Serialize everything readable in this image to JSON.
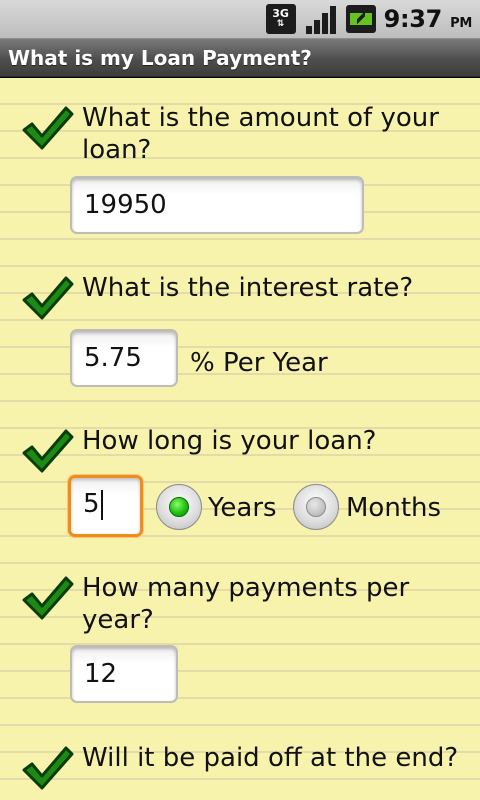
{
  "status_bar": {
    "network": "3G",
    "time": "9:37",
    "ampm": "PM"
  },
  "title_bar": {
    "title": "What is my Loan Payment?"
  },
  "questions": [
    {
      "label": "What is the amount of your loan?",
      "label_line1": "What is the amount of your",
      "label_line2": "loan?",
      "value": "19950"
    },
    {
      "label": "What is the interest rate?",
      "value": "5.75",
      "unit": "% Per Year"
    },
    {
      "label": "How long is your loan?",
      "value": "5",
      "options": [
        "Years",
        "Months"
      ],
      "selected": "Years"
    },
    {
      "label": "How many payments per year?",
      "label_line1": "How many payments per",
      "label_line2": "year?",
      "value": "12"
    },
    {
      "label": "Will it be paid off at the end?"
    }
  ],
  "colors": {
    "paper": "#f7f3ad",
    "check": "#1d8a16",
    "focus": "#f08c1a",
    "radio_selected": "#1fbf12"
  },
  "icons": {
    "check": "checkmark-icon",
    "network": "network-3g-icon",
    "signal": "signal-icon",
    "battery": "battery-charging-icon"
  }
}
